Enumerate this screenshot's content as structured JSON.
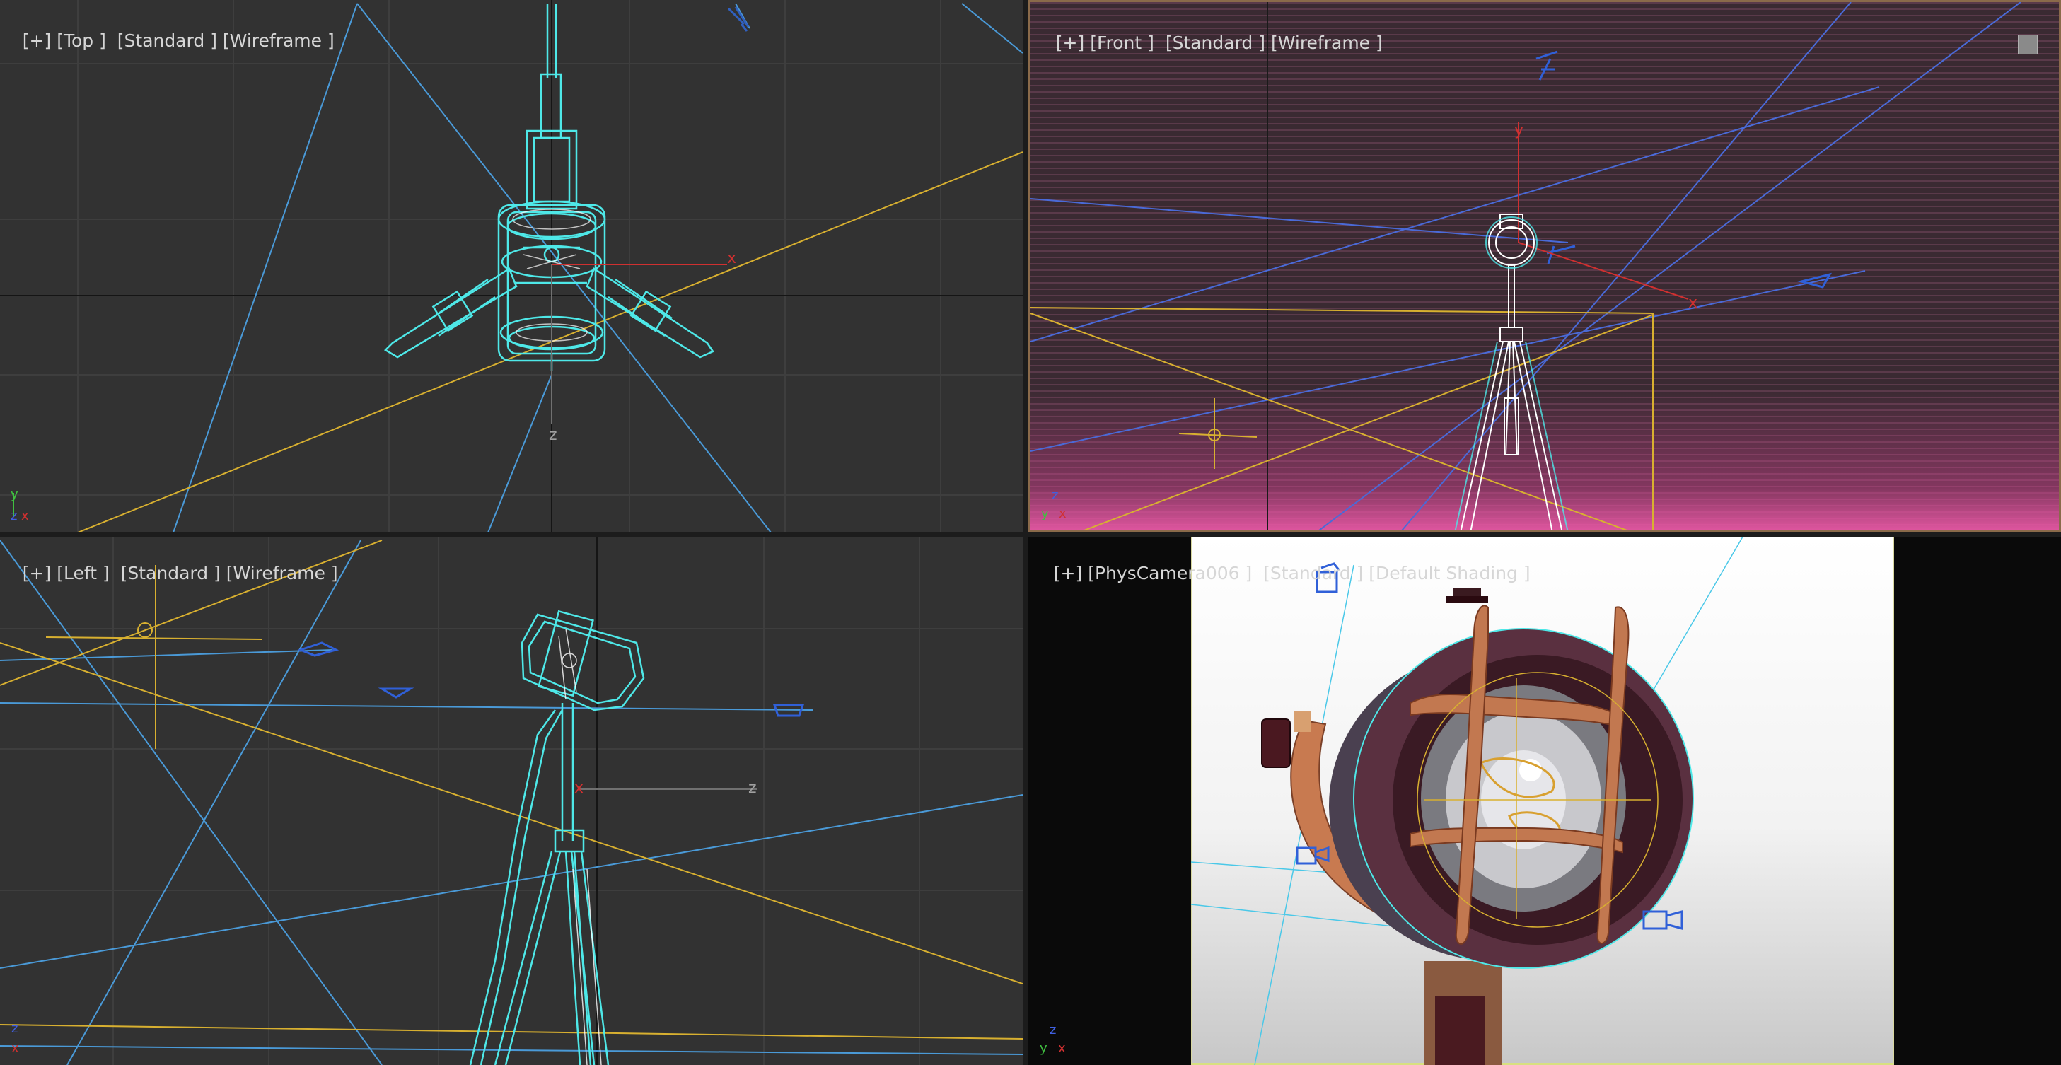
{
  "viewports": {
    "top": {
      "plus": "[+]",
      "view": "[Top ]",
      "shading": "[Standard ]",
      "mode": "[Wireframe ]",
      "axis_x": "x",
      "axis_z": "z"
    },
    "front": {
      "plus": "[+]",
      "view": "[Front ]",
      "shading": "[Standard ]",
      "mode": "[Wireframe ]",
      "axis_x": "x",
      "axis_y": "y"
    },
    "left": {
      "plus": "[+]",
      "view": "[Left ]",
      "shading": "[Standard ]",
      "mode": "[Wireframe ]",
      "axis_x": "x",
      "axis_z": "z"
    },
    "camera": {
      "plus": "[+]",
      "view": "[PhysCamera006 ]",
      "shading": "[Standard ]",
      "mode": "[Default Shading ]"
    }
  },
  "gizmo": {
    "x": "x",
    "y": "y",
    "z": "z"
  },
  "colors": {
    "viewport_bg": "#323232",
    "wire_cyan": "#4ee8e8",
    "wire_blue": "#4a9ad8",
    "wire_yellow": "#d8b030",
    "axis_red": "#d03030",
    "front_stripe": "#7a3a5a",
    "active_border": "#d8d8a0",
    "lamp_copper": "#b87048",
    "lamp_body": "#3a2830"
  },
  "icons": [
    "plus-menu-icon",
    "camera-icon",
    "light-icon",
    "tripod-lamp-model",
    "axis-gizmo-icon",
    "maximize-icon"
  ]
}
